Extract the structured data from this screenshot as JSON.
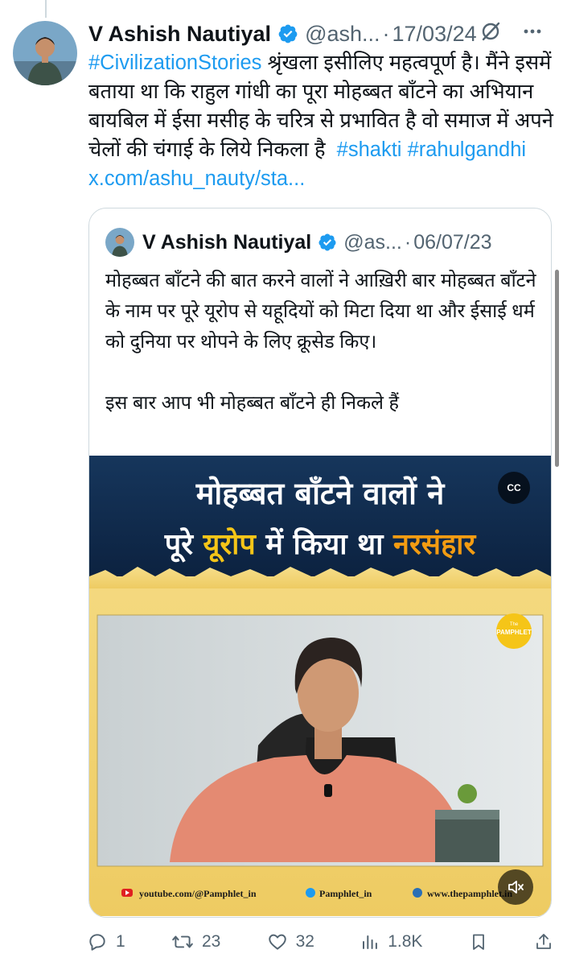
{
  "tweet": {
    "author_name": "V Ashish Nautiyal",
    "handle": "@ash...",
    "separator": "·",
    "date": "17/03/24",
    "text_parts": [
      {
        "text": "#CivilizationStories",
        "link": true
      },
      {
        "text": " श्रृंखला इसीलिए महत्वपूर्ण है। मैंने इसमें बताया था कि राहुल गांधी का पूरा मोहब्बत बाँटने का अभियान बायबिल में ईसा मसीह के चरित्र से प्रभावित है वो समाज में अपने चेलों की चंगाई के लिये निकला है ",
        "link": false
      },
      {
        "text": " #shakti",
        "link": true
      },
      {
        "text": " ",
        "link": false
      },
      {
        "text": "#rahulgandhi",
        "link": true
      },
      {
        "text": " x.com/ashu_nauty/sta...",
        "link": true
      }
    ]
  },
  "quoted": {
    "author_name": "V Ashish Nautiyal",
    "handle": "@as...",
    "separator": "·",
    "date": "06/07/23",
    "text": "मोहब्बत बाँटने की बात करने वालों ने आख़िरी बार मोहब्बत बाँटने के नाम पर पूरे यूरोप से यहूदियों को मिटा दिया था और ईसाई धर्म को दुनिया पर थोपने के लिए क्रूसेड किए।\n\nइस बार आप भी मोहब्बत बाँटने ही निकले हैं",
    "media": {
      "headline_line1": "मोहब्बत बाँटने वालों ने",
      "headline_line2_a": "पूरे ",
      "headline_line2_b": "यूरोप",
      "headline_line2_c": " में किया था ",
      "headline_line2_d": "नरसंहार",
      "cc_label": "CC",
      "logo_top": "The",
      "logo_text": "PAMPHLET",
      "footer_youtube": "youtube.com/@Pamphlet_in",
      "footer_twitter": "Pamphlet_in",
      "footer_web": "www.thepamphlet.in"
    }
  },
  "actions": {
    "replies": "1",
    "reposts": "23",
    "likes": "32",
    "views": "1.8K"
  },
  "colors": {
    "link": "#1d9bf0",
    "muted": "#536471",
    "verified": "#1d9bf0",
    "banner_navy": "#0f2a4a",
    "banner_yellow": "#f5c518",
    "banner_orange": "#f39c12"
  }
}
